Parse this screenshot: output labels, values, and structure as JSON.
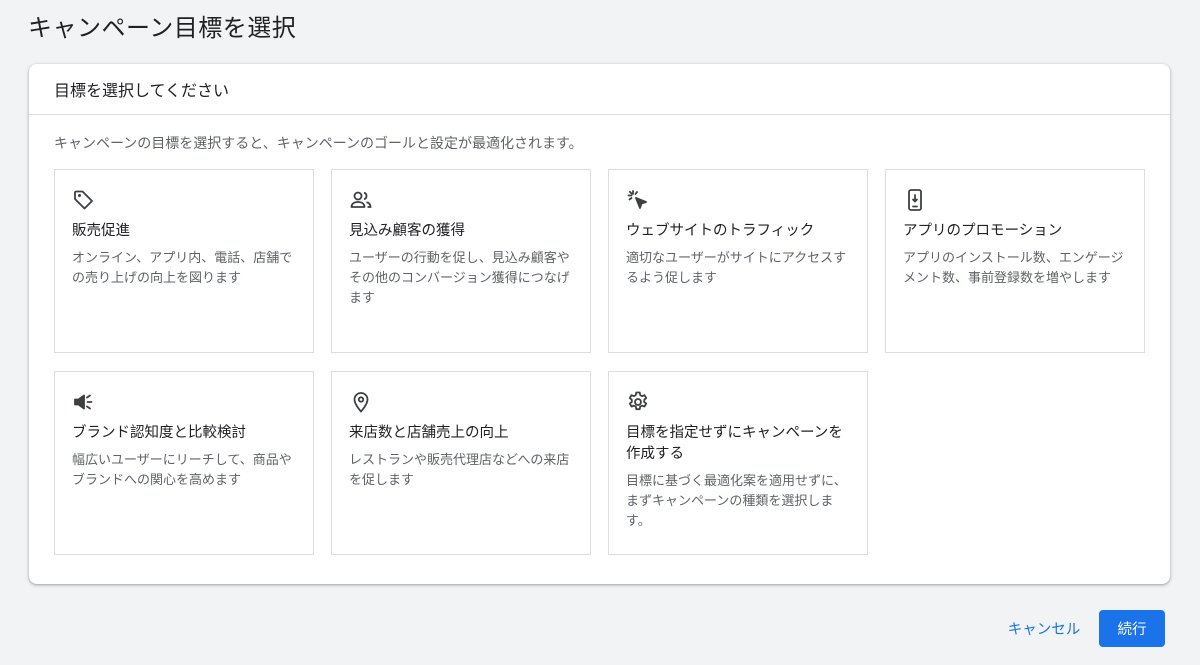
{
  "page": {
    "title": "キャンペーン目標を選択"
  },
  "panel": {
    "header": "目標を選択してください",
    "description": "キャンペーンの目標を選択すると、キャンペーンのゴールと設定が最適化されます。"
  },
  "goals": [
    {
      "icon": "tag-icon",
      "title": "販売促進",
      "description": "オンライン、アプリ内、電話、店舗での売り上げの向上を図ります"
    },
    {
      "icon": "people-icon",
      "title": "見込み顧客の獲得",
      "description": "ユーザーの行動を促し、見込み顧客やその他のコンバージョン獲得につなげます"
    },
    {
      "icon": "cursor-click-icon",
      "title": "ウェブサイトのトラフィック",
      "description": "適切なユーザーがサイトにアクセスするよう促します"
    },
    {
      "icon": "phone-download-icon",
      "title": "アプリのプロモーション",
      "description": "アプリのインストール数、エンゲージメント数、事前登録数を増やします"
    },
    {
      "icon": "megaphone-icon",
      "title": "ブランド認知度と比較検討",
      "description": "幅広いユーザーにリーチして、商品やブランドへの関心を高めます"
    },
    {
      "icon": "location-pin-icon",
      "title": "来店数と店舗売上の向上",
      "description": "レストランや販売代理店などへの来店を促します"
    },
    {
      "icon": "gear-icon",
      "title": "目標を指定せずにキャンペーンを作成する",
      "description": "目標に基づく最適化案を適用せずに、まずキャンペーンの種類を選択します。"
    }
  ],
  "footer": {
    "cancel_label": "キャンセル",
    "continue_label": "続行"
  },
  "colors": {
    "accent": "#1a73e8",
    "background": "#f1f3f4",
    "card_border": "#dadce0"
  }
}
